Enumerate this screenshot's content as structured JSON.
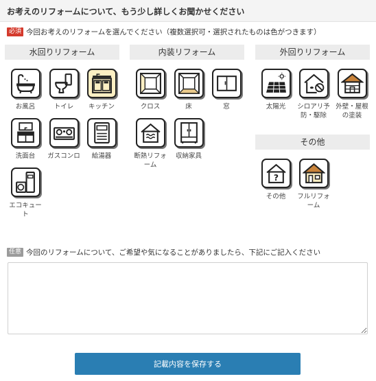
{
  "header": {
    "title": "お考えのリフォームについて、もう少し詳しくお聞かせください"
  },
  "required_row": {
    "badge": "必須",
    "text": "今回お考えのリフォームを選んでください（複数選択可・選択されたものは色がつきます）"
  },
  "categories": {
    "water": "水回りリフォーム",
    "interior": "内装リフォーム",
    "exterior": "外回りリフォーム",
    "other": "その他"
  },
  "items": {
    "bath": {
      "label": "お風呂",
      "icon": "bathtub-icon",
      "selected": false
    },
    "toilet": {
      "label": "トイレ",
      "icon": "toilet-icon",
      "selected": false
    },
    "kitchen": {
      "label": "キッチン",
      "icon": "kitchen-icon",
      "selected": true
    },
    "washbasin": {
      "label": "洗面台",
      "icon": "washbasin-icon",
      "selected": false
    },
    "gas_stove": {
      "label": "ガスコンロ",
      "icon": "gas-stove-icon",
      "selected": false
    },
    "water_heater": {
      "label": "給湯器",
      "icon": "water-heater-icon",
      "selected": false
    },
    "eco_cute": {
      "label": "エコキュート",
      "icon": "eco-cute-icon",
      "selected": false
    },
    "cloth": {
      "label": "クロス",
      "icon": "wallpaper-icon",
      "selected": false
    },
    "floor": {
      "label": "床",
      "icon": "floor-icon",
      "selected": false
    },
    "window": {
      "label": "窓",
      "icon": "window-icon",
      "selected": false
    },
    "insulation": {
      "label": "断熱リフォーム",
      "icon": "insulation-icon",
      "selected": false
    },
    "storage": {
      "label": "収納家具",
      "icon": "wardrobe-icon",
      "selected": false
    },
    "solar": {
      "label": "太陽光",
      "icon": "solar-panel-icon",
      "selected": false
    },
    "termite": {
      "label": "シロアリ予防・駆除",
      "icon": "termite-house-icon",
      "selected": false
    },
    "exterior_paint": {
      "label": "外壁・屋根の塗装",
      "icon": "roof-paint-icon",
      "selected": false
    },
    "other": {
      "label": "その他",
      "icon": "question-house-icon",
      "selected": false
    },
    "full": {
      "label": "フルリフォーム",
      "icon": "full-house-icon",
      "selected": false
    }
  },
  "free_row": {
    "badge": "任意",
    "text": "今回のリフォームについて、ご希望や気になることがありましたら、下記にご記入ください"
  },
  "textarea": {
    "value": "",
    "placeholder": ""
  },
  "save_button": {
    "label": "記載内容を保存する"
  },
  "colors": {
    "accent": "#2a7eb3",
    "selected_tile": "#fcefc3",
    "required_badge": "#d43a2c",
    "optional_badge": "#9b9b9b"
  }
}
